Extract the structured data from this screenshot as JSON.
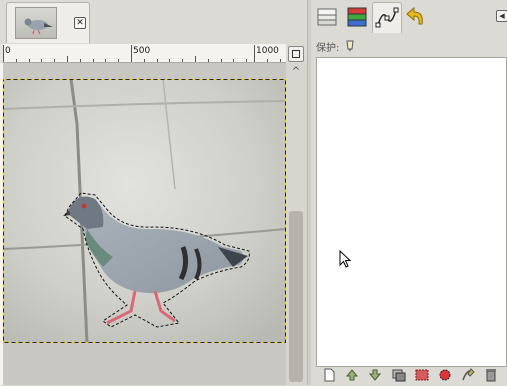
{
  "image_tab": {
    "thumbnail": "pigeon-thumbnail",
    "close_icon": "close-icon"
  },
  "ruler": {
    "labels": [
      "0",
      "500",
      "1000"
    ]
  },
  "dock": {
    "tabs": [
      {
        "name": "layers-tab",
        "icon": "layers-icon"
      },
      {
        "name": "channels-tab",
        "icon": "channels-icon"
      },
      {
        "name": "paths-tab",
        "icon": "paths-icon",
        "active": true
      },
      {
        "name": "undo-history-tab",
        "icon": "undo-history-icon"
      }
    ],
    "lock_label": "保护:",
    "lock_icon": "brush-lock-icon",
    "buttons": [
      "new-path-icon",
      "raise-path-icon",
      "lower-path-icon",
      "duplicate-path-icon",
      "path-to-selection-icon",
      "selection-to-path-icon",
      "paint-along-path-icon",
      "delete-path-icon"
    ]
  },
  "colors": {
    "background": "#dcdad5",
    "selection_marching_ants": "#f0d400",
    "list_background": "#ffffff"
  }
}
